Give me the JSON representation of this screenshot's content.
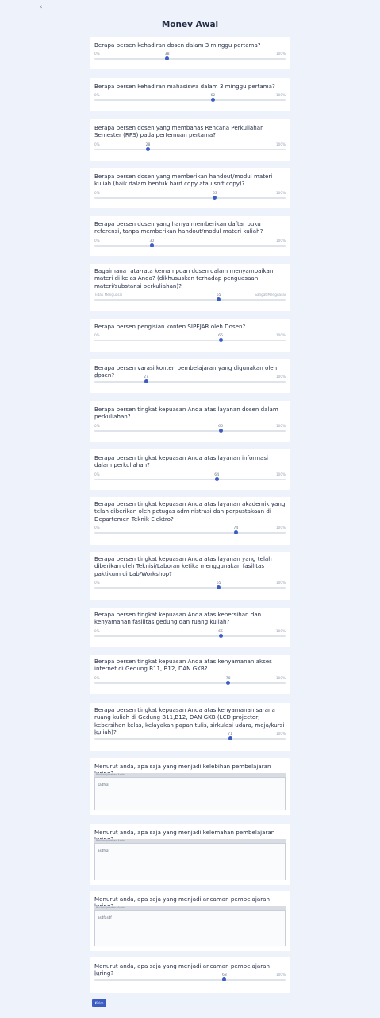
{
  "header": {
    "back_icon": "‹",
    "title": "Monev Awal"
  },
  "questions": [
    {
      "text": "Berapa persen kehadiran dosen dalam 3 minggu pertama?",
      "min": "0%",
      "max": "100%",
      "value": "38",
      "fraction": 0.38
    },
    {
      "text": "Berapa persen kehadiran mahasiswa dalam 3 minggu pertama?",
      "min": "0%",
      "max": "100%",
      "value": "62",
      "fraction": 0.62
    },
    {
      "text": "Berapa persen dosen yang membahas Rencana Perkuliahan Semester (RPS) pada pertemuan pertama?",
      "min": "0%",
      "max": "100%",
      "value": "28",
      "fraction": 0.28
    },
    {
      "text": "Berapa persen dosen yang memberikan handout/modul materi kuliah (baik dalam bentuk hard copy atau soft copy)?",
      "min": "0%",
      "max": "100%",
      "value": "63",
      "fraction": 0.63
    },
    {
      "text": "Berapa persen dosen yang hanya memberikan daftar buku referensi, tanpa memberikan handout/modul materi kuliah?",
      "min": "0%",
      "max": "100%",
      "value": "30",
      "fraction": 0.3
    },
    {
      "text": "Bagaimana rata-rata kemampuan dosen dalam menyampaikan materi di kelas Anda? (dikhususkan terhadap penguasaan materi/substansi perkuliahan)?",
      "min": "Tidak Menguasai",
      "max": "Sangat Menguasai",
      "value": "65",
      "fraction": 0.65
    },
    {
      "text": "Berapa persen pengisian konten SIPEJAR oleh Dosen?",
      "min": "0%",
      "max": "100%",
      "value": "66",
      "fraction": 0.66
    },
    {
      "text": "Berapa persen varasi konten pembelajaran yang digunakan oleh dosen?",
      "min": "0%",
      "max": "100%",
      "value": "27",
      "fraction": 0.27
    },
    {
      "text": "Berapa persen tingkat kepuasan Anda atas layanan dosen dalam perkuliahan?",
      "min": "0%",
      "max": "100%",
      "value": "66",
      "fraction": 0.66
    },
    {
      "text": "Berapa persen tingkat kepuasan Anda atas layanan informasi dalam perkuliahan?",
      "min": "0%",
      "max": "100%",
      "value": "64",
      "fraction": 0.64
    },
    {
      "text": "Berapa persen tingkat kepuasan Anda atas layanan akademik yang telah diberikan oleh petugas administrasi dan perpustakaan di Departemen Teknik Elektro?",
      "min": "0%",
      "max": "100%",
      "value": "74",
      "fraction": 0.74
    },
    {
      "text": "Berapa persen tingkat kepuasan Anda atas layanan yang telah diberikan oleh Teknisi/Laboran ketika menggunakan fasilitas paktikum di Lab/Workshop?",
      "min": "0%",
      "max": "100%",
      "value": "65",
      "fraction": 0.65
    },
    {
      "text": "Berapa persen tingkat kepuasan Anda atas kebersihan dan kenyamanan fasilitas gedung dan ruang kuliah?",
      "min": "0%",
      "max": "100%",
      "value": "66",
      "fraction": 0.66
    },
    {
      "text": "Berapa persen tingkat kepuasan Anda atas kenyamanan akses internet di Gedung B11, B12, DAN GKB?",
      "min": "0%",
      "max": "100%",
      "value": "70",
      "fraction": 0.7
    },
    {
      "text": "Berapa persen tingkat kepuasan Anda atas kenyamanan sarana ruang kuliah di Gedung B11,B12, DAN GKB (LCD projector, kebersihan kelas, kelayakan papan tulis, sirkulasi udara, meja/kursi kuliah)?",
      "min": "0%",
      "max": "100%",
      "value": "71",
      "fraction": 0.71
    }
  ],
  "text_questions": [
    {
      "text": "Menurut anda, apa saja yang menjadi kelebihan pembelajaran luring?",
      "label": "Berikan jawaban Anda",
      "value": "sadfsaf"
    },
    {
      "text": "Menurut anda, apa saja yang menjadi kelemahan pembelajaran luring?",
      "label": "Berikan jawaban Anda",
      "value": "asdfsaf"
    },
    {
      "text": "Menurut anda, apa saja yang menjadi ancaman pembelajaran luring?",
      "label": "Berikan jawaban Anda",
      "value": "asdfasdf"
    }
  ],
  "last_question": {
    "text": "Menurut anda, apa saja yang menjadi ancaman pembelajaran luring?",
    "min": "0%",
    "max": "100%",
    "value": "68",
    "fraction": 0.68
  },
  "submit_label": "Kirim",
  "colors": {
    "accent": "#3c5cc2",
    "background": "#eef2fb",
    "card": "#ffffff"
  }
}
